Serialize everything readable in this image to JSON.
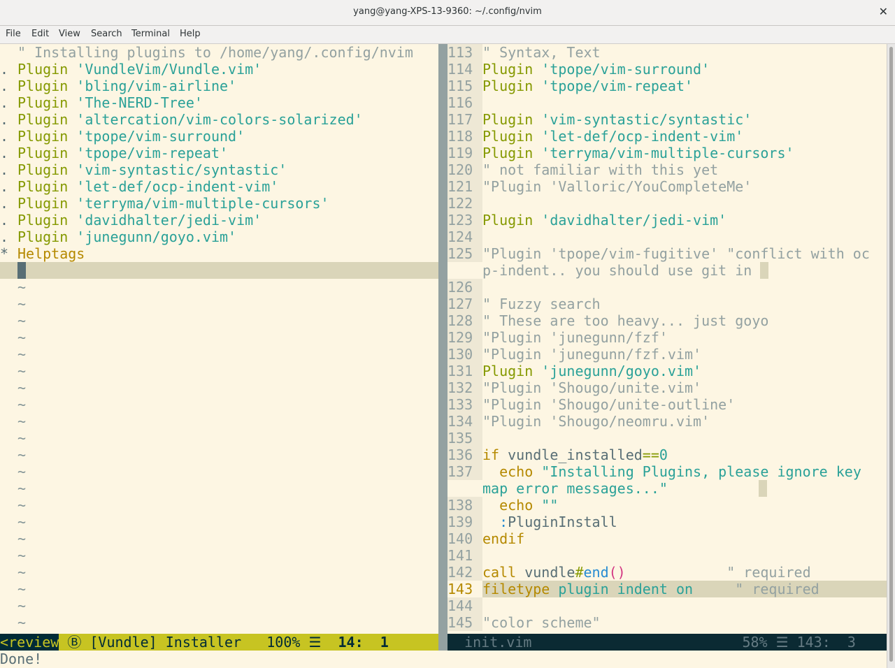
{
  "window": {
    "title": "yang@yang-XPS-13-9360: ~/.config/nvim"
  },
  "menu": [
    "File",
    "Edit",
    "View",
    "Search",
    "Terminal",
    "Help"
  ],
  "left_pane": {
    "lines": [
      {
        "sign": "",
        "segs": [
          [
            "cm",
            "\" Installing plugins to /home/yang/.config/nvim"
          ]
        ]
      },
      {
        "sign": ".",
        "segs": [
          [
            "kw",
            "Plugin "
          ],
          [
            "st",
            "'VundleVim/Vundle.vim'"
          ]
        ]
      },
      {
        "sign": ".",
        "segs": [
          [
            "kw",
            "Plugin "
          ],
          [
            "st",
            "'bling/vim-airline'"
          ]
        ]
      },
      {
        "sign": ".",
        "segs": [
          [
            "kw",
            "Plugin "
          ],
          [
            "st",
            "'The-NERD-Tree'"
          ]
        ]
      },
      {
        "sign": ".",
        "segs": [
          [
            "kw",
            "Plugin "
          ],
          [
            "st",
            "'altercation/vim-colors-solarized'"
          ]
        ]
      },
      {
        "sign": ".",
        "segs": [
          [
            "kw",
            "Plugin "
          ],
          [
            "st",
            "'tpope/vim-surround'"
          ]
        ]
      },
      {
        "sign": ".",
        "segs": [
          [
            "kw",
            "Plugin "
          ],
          [
            "st",
            "'tpope/vim-repeat'"
          ]
        ]
      },
      {
        "sign": ".",
        "segs": [
          [
            "kw",
            "Plugin "
          ],
          [
            "st",
            "'vim-syntastic/syntastic'"
          ]
        ]
      },
      {
        "sign": ".",
        "segs": [
          [
            "kw",
            "Plugin "
          ],
          [
            "st",
            "'let-def/ocp-indent-vim'"
          ]
        ]
      },
      {
        "sign": ".",
        "segs": [
          [
            "kw",
            "Plugin "
          ],
          [
            "st",
            "'terryma/vim-multiple-cursors'"
          ]
        ]
      },
      {
        "sign": ".",
        "segs": [
          [
            "kw",
            "Plugin "
          ],
          [
            "st",
            "'davidhalter/jedi-vim'"
          ]
        ]
      },
      {
        "sign": ".",
        "segs": [
          [
            "kw",
            "Plugin "
          ],
          [
            "st",
            "'junegunn/goyo.vim'"
          ]
        ]
      },
      {
        "sign": "*",
        "segs": [
          [
            "hg",
            "Helptags"
          ]
        ]
      }
    ],
    "tilde": "~",
    "tilde_count": 21
  },
  "right_pane": {
    "lines": [
      {
        "n": "113",
        "segs": [
          [
            "cm",
            "\" Syntax, Text"
          ]
        ]
      },
      {
        "n": "114",
        "segs": [
          [
            "kw",
            "Plugin "
          ],
          [
            "st",
            "'tpope/vim-surround'"
          ]
        ]
      },
      {
        "n": "115",
        "segs": [
          [
            "kw",
            "Plugin "
          ],
          [
            "st",
            "'tpope/vim-repeat'"
          ]
        ]
      },
      {
        "n": "116",
        "segs": []
      },
      {
        "n": "117",
        "segs": [
          [
            "kw",
            "Plugin "
          ],
          [
            "st",
            "'vim-syntastic/syntastic'"
          ]
        ]
      },
      {
        "n": "118",
        "segs": [
          [
            "kw",
            "Plugin "
          ],
          [
            "st",
            "'let-def/ocp-indent-vim'"
          ]
        ]
      },
      {
        "n": "119",
        "segs": [
          [
            "kw",
            "Plugin "
          ],
          [
            "st",
            "'terryma/vim-multiple-cursors'"
          ]
        ]
      },
      {
        "n": "120",
        "segs": [
          [
            "cm",
            "\" not familiar with this yet"
          ]
        ]
      },
      {
        "n": "121",
        "segs": [
          [
            "cm",
            "\"Plugin 'Valloric/YouCompleteMe'"
          ]
        ]
      },
      {
        "n": "122",
        "segs": []
      },
      {
        "n": "123",
        "segs": [
          [
            "kw",
            "Plugin "
          ],
          [
            "st",
            "'davidhalter/jedi-vim'"
          ]
        ]
      },
      {
        "n": "124",
        "segs": []
      },
      {
        "n": "125",
        "segs": [
          [
            "cm",
            "\"Plugin 'tpope/vim-fugitive' \"conflict with oc"
          ]
        ]
      },
      {
        "n": "",
        "segs": [
          [
            "cm",
            "p-indent.. you should use git in "
          ]
        ]
      },
      {
        "n": "126",
        "segs": []
      },
      {
        "n": "127",
        "segs": [
          [
            "cm",
            "\" Fuzzy search"
          ]
        ]
      },
      {
        "n": "128",
        "segs": [
          [
            "cm",
            "\" These are too heavy... just goyo"
          ]
        ]
      },
      {
        "n": "129",
        "segs": [
          [
            "cm",
            "\"Plugin 'junegunn/fzf'"
          ]
        ]
      },
      {
        "n": "130",
        "segs": [
          [
            "cm",
            "\"Plugin 'junegunn/fzf.vim'"
          ]
        ]
      },
      {
        "n": "131",
        "segs": [
          [
            "kw",
            "Plugin "
          ],
          [
            "st",
            "'junegunn/goyo.vim'"
          ]
        ]
      },
      {
        "n": "132",
        "segs": [
          [
            "cm",
            "\"Plugin 'Shougo/unite.vim'"
          ]
        ]
      },
      {
        "n": "133",
        "segs": [
          [
            "cm",
            "\"Plugin 'Shougo/unite-outline'"
          ]
        ]
      },
      {
        "n": "134",
        "segs": [
          [
            "cm",
            "\"Plugin 'Shougo/neomru.vim'"
          ]
        ]
      },
      {
        "n": "135",
        "segs": []
      },
      {
        "n": "136",
        "segs": [
          [
            "hg",
            "if "
          ],
          [
            "tx",
            "vundle_installed"
          ],
          [
            "kw",
            "=="
          ],
          [
            "st",
            "0"
          ]
        ]
      },
      {
        "n": "137",
        "segs": [
          [
            "hg",
            "  echo "
          ],
          [
            "st",
            "\"Installing Plugins, please ignore key"
          ]
        ]
      },
      {
        "n": "",
        "segs": [
          [
            "st",
            "map error messages...\""
          ]
        ]
      },
      {
        "n": "138",
        "segs": [
          [
            "hg",
            "  echo "
          ],
          [
            "st",
            "\"\""
          ]
        ]
      },
      {
        "n": "139",
        "segs": [
          [
            "fn",
            "  :"
          ],
          [
            "tx",
            "PluginInstall"
          ]
        ]
      },
      {
        "n": "140",
        "segs": [
          [
            "hg",
            "endif"
          ]
        ]
      },
      {
        "n": "141",
        "segs": []
      },
      {
        "n": "142",
        "segs": [
          [
            "hg",
            "call "
          ],
          [
            "tx",
            "vundle"
          ],
          [
            "kw",
            "#"
          ],
          [
            "fn",
            "end"
          ],
          [
            "pk",
            "()"
          ],
          [
            "cm",
            "            \" required"
          ]
        ]
      },
      {
        "n": "143",
        "segs": [
          [
            "hg",
            "filetype "
          ],
          [
            "st",
            "plugin indent on"
          ],
          [
            "cm",
            "     \" required"
          ]
        ]
      },
      {
        "n": "144",
        "segs": []
      },
      {
        "n": "145",
        "segs": [
          [
            "cm",
            "\"color scheme\""
          ]
        ]
      }
    ]
  },
  "status_left": {
    "mode": "<review",
    "icon": "Ⓑ",
    "name": "[Vundle] Installer",
    "percent": "100%",
    "lines_icon": "☰",
    "pos": "14:  1"
  },
  "status_right": {
    "file": "init.vim",
    "percent": "58%",
    "lines_icon": "☰",
    "pos": "143:  3"
  },
  "cmdline": "Done!"
}
